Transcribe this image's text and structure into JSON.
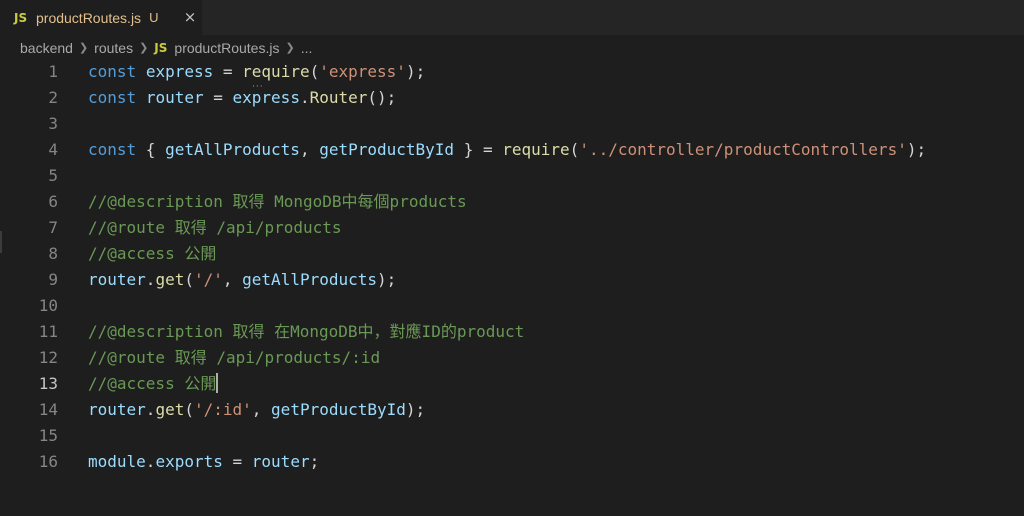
{
  "tab": {
    "icon_label": "JS",
    "filename": "productRoutes.js",
    "status": "U",
    "close_glyph": "×"
  },
  "breadcrumb": {
    "items": [
      "backend",
      "routes",
      "productRoutes.js",
      "..."
    ],
    "file_icon_label": "JS"
  },
  "editor": {
    "active_line": 13,
    "lines": [
      {
        "n": "1",
        "tokens": [
          [
            "kw",
            "const"
          ],
          [
            "pl",
            " "
          ],
          [
            "var",
            "express"
          ],
          [
            "pl",
            " = "
          ],
          [
            "fn",
            "require"
          ],
          [
            "pl",
            "("
          ],
          [
            "str",
            "'express'"
          ],
          [
            "pl",
            ");"
          ]
        ]
      },
      {
        "n": "2",
        "tokens": [
          [
            "kw",
            "const"
          ],
          [
            "pl",
            " "
          ],
          [
            "var",
            "router"
          ],
          [
            "pl",
            " = "
          ],
          [
            "var",
            "express"
          ],
          [
            "pl",
            "."
          ],
          [
            "fn",
            "Router"
          ],
          [
            "pl",
            "();"
          ]
        ]
      },
      {
        "n": "3",
        "tokens": []
      },
      {
        "n": "4",
        "tokens": [
          [
            "kw",
            "const"
          ],
          [
            "pl",
            " { "
          ],
          [
            "var",
            "getAllProducts"
          ],
          [
            "pl",
            ", "
          ],
          [
            "var",
            "getProductById"
          ],
          [
            "pl",
            " } = "
          ],
          [
            "fn",
            "require"
          ],
          [
            "pl",
            "("
          ],
          [
            "str",
            "'../controller/productControllers'"
          ],
          [
            "pl",
            ");"
          ]
        ]
      },
      {
        "n": "5",
        "tokens": []
      },
      {
        "n": "6",
        "tokens": [
          [
            "cm",
            "//@description 取得 MongoDB中每個products"
          ]
        ]
      },
      {
        "n": "7",
        "tokens": [
          [
            "cm",
            "//@route 取得 /api/products"
          ]
        ]
      },
      {
        "n": "8",
        "tokens": [
          [
            "cm",
            "//@access 公開"
          ]
        ]
      },
      {
        "n": "9",
        "tokens": [
          [
            "var",
            "router"
          ],
          [
            "pl",
            "."
          ],
          [
            "fn",
            "get"
          ],
          [
            "pl",
            "("
          ],
          [
            "str",
            "'/'"
          ],
          [
            "pl",
            ", "
          ],
          [
            "var",
            "getAllProducts"
          ],
          [
            "pl",
            ");"
          ]
        ]
      },
      {
        "n": "10",
        "tokens": []
      },
      {
        "n": "11",
        "tokens": [
          [
            "cm",
            "//@description 取得 在MongoDB中，對應ID的product"
          ]
        ]
      },
      {
        "n": "12",
        "tokens": [
          [
            "cm",
            "//@route 取得 /api/products/:id"
          ]
        ]
      },
      {
        "n": "13",
        "tokens": [
          [
            "cm",
            "//@access 公開"
          ]
        ],
        "cursor": true
      },
      {
        "n": "14",
        "tokens": [
          [
            "var",
            "router"
          ],
          [
            "pl",
            "."
          ],
          [
            "fn",
            "get"
          ],
          [
            "pl",
            "("
          ],
          [
            "str",
            "'/:id'"
          ],
          [
            "pl",
            ", "
          ],
          [
            "var",
            "getProductById"
          ],
          [
            "pl",
            ");"
          ]
        ]
      },
      {
        "n": "15",
        "tokens": []
      },
      {
        "n": "16",
        "tokens": [
          [
            "var",
            "module"
          ],
          [
            "pl",
            "."
          ],
          [
            "var",
            "exports"
          ],
          [
            "pl",
            " = "
          ],
          [
            "var",
            "router"
          ],
          [
            "pl",
            ";"
          ]
        ]
      }
    ]
  },
  "hint_dots": "···"
}
